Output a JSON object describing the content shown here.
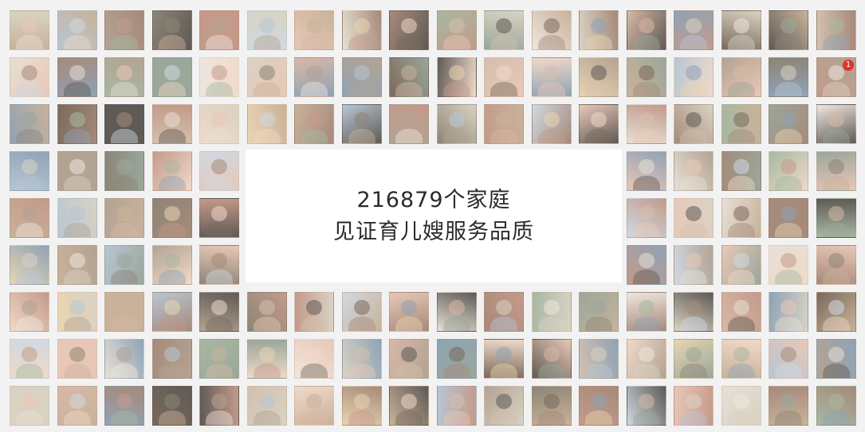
{
  "banner": {
    "headline": "216879个家庭",
    "subline": "见证育儿嫂服务品质"
  },
  "wall": {
    "tile_count": 153,
    "photo_palette": [
      "#c9b29a",
      "#8d8577",
      "#e9c7b6",
      "#a7b8a1",
      "#d9d2c3",
      "#7a6a5c",
      "#f0d9c8",
      "#b7c6d4",
      "#c49a8a",
      "#e6e0d5",
      "#9aa79a",
      "#d7b8a6",
      "#5f5a55",
      "#e9d4b0",
      "#b3a393",
      "#cfd9e2",
      "#a68a7a",
      "#efe6df",
      "#8fa3b5",
      "#d3c0ae"
    ],
    "notification_badge": "1"
  }
}
